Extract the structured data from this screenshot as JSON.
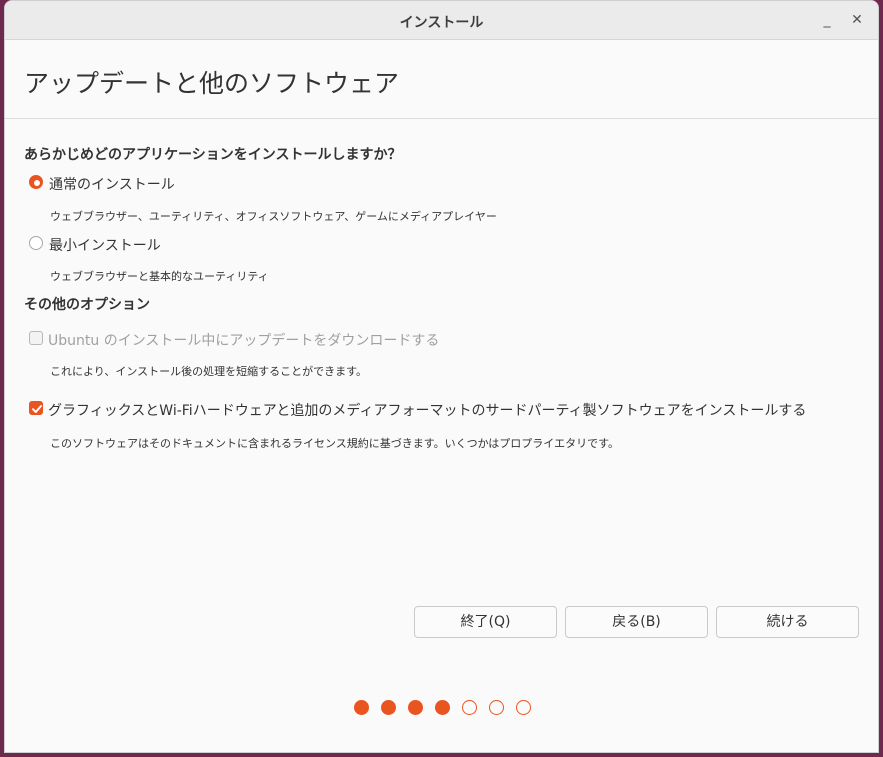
{
  "window": {
    "title": "インストール",
    "minimize_glyph": "_",
    "close_glyph": "✕"
  },
  "header": {
    "title": "アップデートと他のソフトウェア"
  },
  "install_type": {
    "question": "あらかじめどのアプリケーションをインストールしますか？",
    "options": [
      {
        "label": "通常のインストール",
        "description": "ウェブブラウザー、ユーティリティ、オフィスソフトウェア、ゲームにメディアプレイヤー",
        "selected": true
      },
      {
        "label": "最小インストール",
        "description": "ウェブブラウザーと基本的なユーティリティ",
        "selected": false
      }
    ]
  },
  "other_options": {
    "heading": "その他のオプション",
    "items": [
      {
        "label": "Ubuntu のインストール中にアップデートをダウンロードする",
        "description": "これにより、インストール後の処理を短縮することができます。",
        "checked": false,
        "enabled": false
      },
      {
        "label": "グラフィックスとWi-Fiハードウェアと追加のメディアフォーマットのサードパーティ製ソフトウェアをインストールする",
        "description": "このソフトウェアはそのドキュメントに含まれるライセンス規約に基づきます。いくつかはプロプライエタリです。",
        "checked": true,
        "enabled": true
      }
    ]
  },
  "buttons": {
    "quit": "終了(Q)",
    "back": "戻る(B)",
    "continue": "続ける"
  },
  "progress": {
    "current_step": 4,
    "total_steps": 7
  },
  "colors": {
    "accent": "#e95420",
    "desktop_background": "#6e2a4e"
  }
}
